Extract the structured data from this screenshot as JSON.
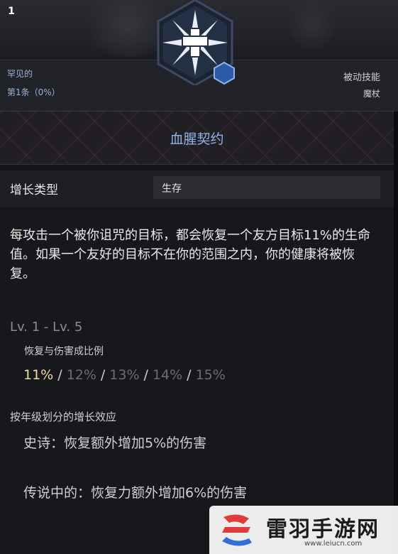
{
  "header": {
    "rarity": "罕见的",
    "count_label": "第1条（0%）",
    "skill_type": "被动技能",
    "weapon": "魔杖"
  },
  "skill": {
    "level_badge": "1",
    "name": "血腥契约",
    "growth_type_label": "增长类型",
    "growth_type_value": "生存",
    "description": "每攻击一个被你诅咒的目标，都会恢复一个友方目标11%的生命值。如果一个友好的目标不在你的范围之内，你的健康将被恢复。"
  },
  "levels": {
    "range": "Lv. 1 - Lv. 5",
    "scale_label": "恢复与伤害成比例",
    "values": [
      "11%",
      "12%",
      "13%",
      "14%",
      "15%"
    ],
    "separator": "/",
    "current_index": 0
  },
  "upgrades": {
    "label": "按年级划分的增长效应",
    "epic": "史诗：恢复额外增加5%的伤害",
    "legendary": "传说中的：恢复力额外增加6%的伤害"
  },
  "watermark": {
    "text": "雷羽手游网",
    "url": "www.leiucn.com"
  },
  "colors": {
    "title_blue": "#8fb4e6",
    "current_level": "#f2dc9e",
    "rarity_blue": "#9bb3d6"
  },
  "icons": {
    "emblem": "cross-star-emblem-icon",
    "badge": "hexagon-level-badge-icon",
    "watermark_logo": "leiyu-logo-icon"
  }
}
